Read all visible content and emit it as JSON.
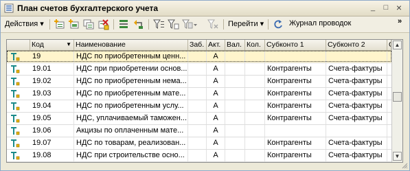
{
  "window": {
    "title": "План счетов бухгалтерского учета",
    "buttons": {
      "minimize": "_",
      "maximize": "□",
      "close": "×"
    }
  },
  "toolbar": {
    "actions_label": "Действия",
    "goto_label": "Перейти",
    "journal_label": "Журнал проводок"
  },
  "grid": {
    "columns": [
      "Код",
      "Наименование",
      "Заб.",
      "Акт.",
      "Вал.",
      "Кол.",
      "Субконто 1",
      "Субконто 2",
      "С"
    ],
    "rows": [
      {
        "code": "19",
        "name": "НДС по приобретенным ценн...",
        "zab": "",
        "akt": "А",
        "val": "",
        "kol": "",
        "sub1": "",
        "sub2": "",
        "selected": true
      },
      {
        "code": "19.01",
        "name": "НДС при приобретении основ...",
        "zab": "",
        "akt": "А",
        "val": "",
        "kol": "",
        "sub1": "Контрагенты",
        "sub2": "Счета-фактуры"
      },
      {
        "code": "19.02",
        "name": "НДС по приобретенным нема...",
        "zab": "",
        "akt": "А",
        "val": "",
        "kol": "",
        "sub1": "Контрагенты",
        "sub2": "Счета-фактуры"
      },
      {
        "code": "19.03",
        "name": "НДС по приобретенным мате...",
        "zab": "",
        "akt": "А",
        "val": "",
        "kol": "",
        "sub1": "Контрагенты",
        "sub2": "Счета-фактуры"
      },
      {
        "code": "19.04",
        "name": "НДС по приобретенным услу...",
        "zab": "",
        "akt": "А",
        "val": "",
        "kol": "",
        "sub1": "Контрагенты",
        "sub2": "Счета-фактуры"
      },
      {
        "code": "19.05",
        "name": "НДС, уплачиваемый таможен...",
        "zab": "",
        "akt": "А",
        "val": "",
        "kol": "",
        "sub1": "Контрагенты",
        "sub2": "Счета-фактуры"
      },
      {
        "code": "19.06",
        "name": "Акцизы по оплаченным мате...",
        "zab": "",
        "akt": "А",
        "val": "",
        "kol": "",
        "sub1": "",
        "sub2": ""
      },
      {
        "code": "19.07",
        "name": "НДС по товарам, реализован...",
        "zab": "",
        "akt": "А",
        "val": "",
        "kol": "",
        "sub1": "Контрагенты",
        "sub2": "Счета-фактуры"
      },
      {
        "code": "19.08",
        "name": "НДС при строительстве осно...",
        "zab": "",
        "akt": "А",
        "val": "",
        "kol": "",
        "sub1": "Контрагенты",
        "sub2": "Счета-фактуры"
      }
    ]
  },
  "colors": {
    "selected_row": "#fff5cc",
    "icon_teal": "#1a8a8a",
    "icon_yellow": "#e8b400"
  }
}
